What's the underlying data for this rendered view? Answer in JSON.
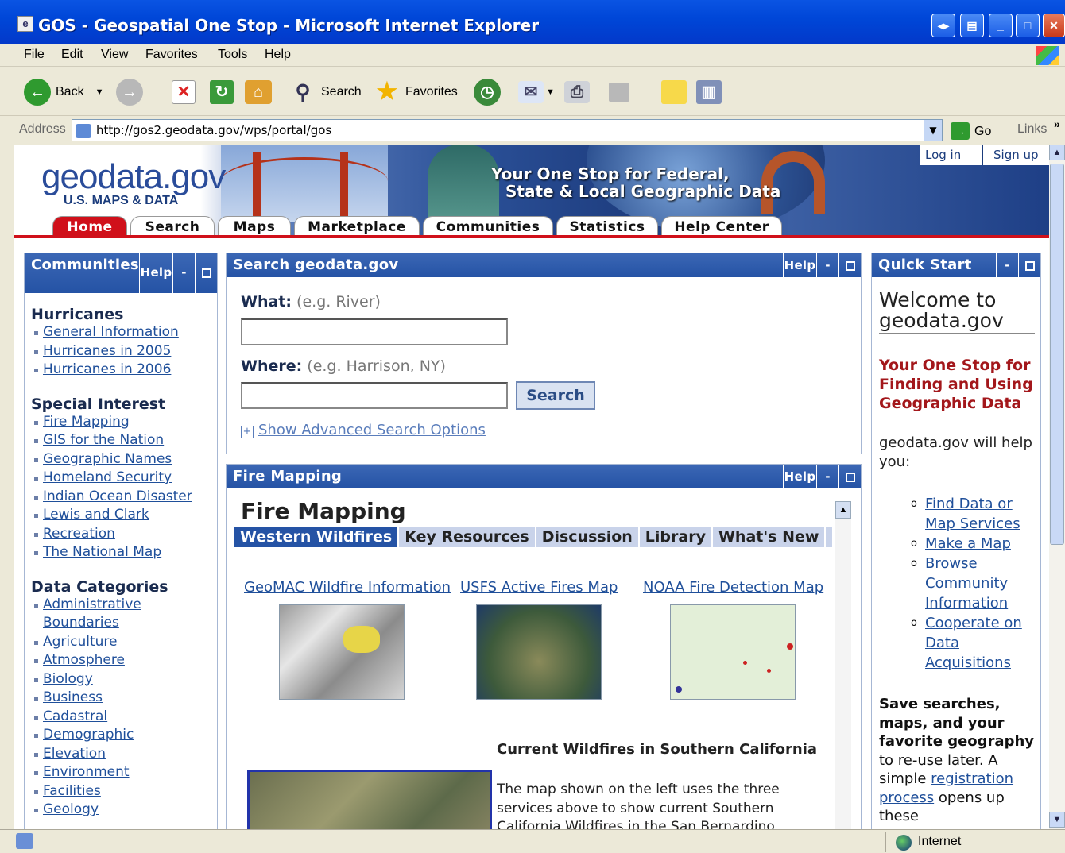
{
  "window": {
    "title": "GOS - Geospatial One Stop - Microsoft Internet Explorer"
  },
  "menu": [
    "File",
    "Edit",
    "View",
    "Favorites",
    "Tools",
    "Help"
  ],
  "toolbar": {
    "back": "Back",
    "search": "Search",
    "favorites": "Favorites"
  },
  "address": {
    "label": "Address",
    "url": "http://gos2.geodata.gov/wps/portal/gos",
    "go": "Go",
    "links": "Links"
  },
  "banner": {
    "logo_geo": "geo",
    "logo_data": "data",
    "logo_gov": ".gov",
    "logo_sub": "U.S. MAPS & DATA",
    "tagline1": "Your One Stop for Federal,",
    "tagline2": "State & Local Geographic Data",
    "login": "Log in",
    "signup": "Sign up"
  },
  "nav": [
    "Home",
    "Search",
    "Maps",
    "Marketplace",
    "Communities",
    "Statistics",
    "Help Center"
  ],
  "portlet_controls": {
    "help": "Help",
    "min": "-"
  },
  "communities": {
    "title": "Communities",
    "hurricanes_title": "Hurricanes",
    "hurricanes": [
      "General Information",
      "Hurricanes in 2005",
      "Hurricanes in 2006"
    ],
    "special_title": "Special Interest",
    "special": [
      "Fire Mapping",
      "GIS for the Nation",
      "Geographic Names",
      "Homeland Security",
      "Indian Ocean Disaster",
      "Lewis and Clark",
      "Recreation",
      "The National Map"
    ],
    "data_title": "Data Categories",
    "data": [
      "Administrative Boundaries",
      "Agriculture",
      "Atmosphere",
      "Biology",
      "Business",
      "Cadastral",
      "Demographic",
      "Elevation",
      "Environment",
      "Facilities",
      "Geology"
    ]
  },
  "search": {
    "title": "Search geodata.gov",
    "what_label": "What:",
    "what_hint": "(e.g. River)",
    "where_label": "Where:",
    "where_hint": "(e.g. Harrison, NY)",
    "button": "Search",
    "advanced": "Show Advanced Search Options"
  },
  "fire": {
    "title": "Fire Mapping",
    "heading": "Fire Mapping",
    "tabs": [
      "Western Wildfires",
      "Key Resources",
      "Discussion",
      "Library",
      "What's New"
    ],
    "links": [
      "GeoMAC Wildfire Information",
      "USFS Active Fires Map",
      "NOAA Fire Detection Map"
    ],
    "current_title": "Current Wildfires in Southern California",
    "desc1": "The map shown on the left uses the three",
    "desc2": "services above to show current Southern",
    "desc3": "California Wildfires in the San Bernardino"
  },
  "quickstart": {
    "title": "Quick Start",
    "welcome": "Welcome to geodata.gov",
    "tagline": "Your One Stop for Finding and Using Geographic Data",
    "intro": "geodata.gov will help you:",
    "items": [
      "Find Data or Map Services",
      "Make a Map",
      "Browse Community Information",
      "Cooperate on Data Acquisitions"
    ],
    "save_bold": "Save searches, maps, and your favorite geography",
    "save_rest": "to re-use later. A simple",
    "reg_link": "registration process",
    "opens": "opens up these"
  },
  "status": {
    "zone": "Internet"
  }
}
